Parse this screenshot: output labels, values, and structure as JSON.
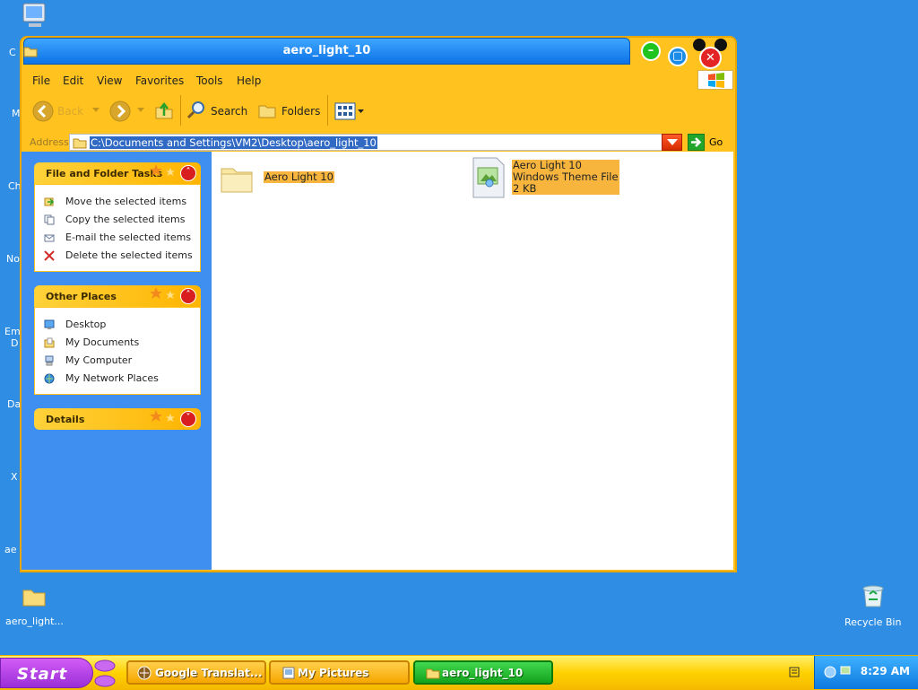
{
  "desktop": {
    "left_clipped_labels": [
      "C",
      "M",
      "Ch",
      "No",
      "Em",
      "D",
      "Da",
      "X",
      "ae"
    ],
    "folder_icon_label": "aero_light...",
    "recycle_bin_label": "Recycle Bin"
  },
  "window": {
    "title": "aero_light_10",
    "menu": [
      "File",
      "Edit",
      "View",
      "Favorites",
      "Tools",
      "Help"
    ],
    "toolbar": {
      "back": "Back",
      "search": "Search",
      "folders": "Folders"
    },
    "address": {
      "label": "Address",
      "value": "C:\\Documents and Settings\\VM2\\Desktop\\aero_light_10",
      "go": "Go"
    },
    "left_pane": {
      "file_folder_tasks": {
        "title": "File and Folder Tasks",
        "items": [
          {
            "label": "Move the selected items",
            "icon": "move-icon"
          },
          {
            "label": "Copy the selected items",
            "icon": "copy-icon"
          },
          {
            "label": "E-mail the selected items",
            "icon": "email-icon"
          },
          {
            "label": "Delete the selected items",
            "icon": "delete-icon"
          }
        ]
      },
      "other_places": {
        "title": "Other Places",
        "items": [
          {
            "label": "Desktop",
            "icon": "desktop-icon"
          },
          {
            "label": "My Documents",
            "icon": "documents-icon"
          },
          {
            "label": "My Computer",
            "icon": "computer-icon"
          },
          {
            "label": "My Network Places",
            "icon": "network-icon"
          }
        ]
      },
      "details": {
        "title": "Details"
      }
    },
    "files": [
      {
        "name": "Aero Light 10",
        "type": "folder"
      },
      {
        "name": "Aero Light 10",
        "type_label": "Windows Theme File",
        "size": "2 KB"
      }
    ]
  },
  "taskbar": {
    "start": "Start",
    "buttons": [
      {
        "label": "Google Translat..."
      },
      {
        "label": "My Pictures"
      },
      {
        "label": "aero_light_10"
      }
    ],
    "clock": "8:29 AM"
  },
  "colors": {
    "desktop": "#2f8ee3",
    "window_frame": "#ffc21e",
    "title_bar": "#0d72e6",
    "selection": "#316ac5",
    "start_button": "#a93bdf",
    "active_task": "#13a21c"
  }
}
